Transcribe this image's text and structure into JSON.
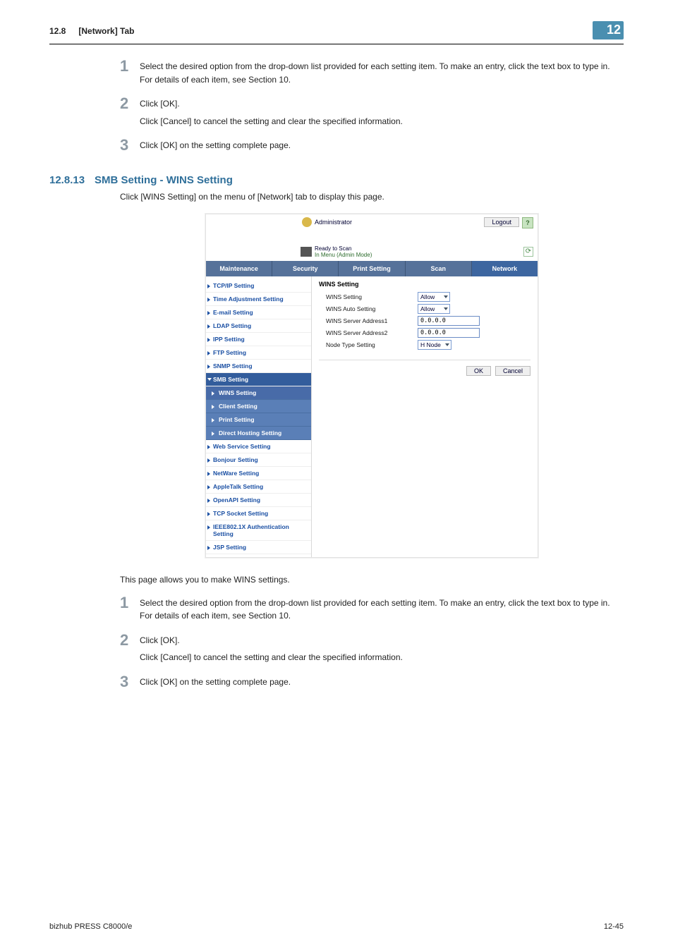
{
  "header": {
    "section": "12.8",
    "title": "[Network] Tab",
    "badge": "12"
  },
  "steps_a": [
    {
      "num": "1",
      "paras": [
        "Select the desired option from the drop-down list provided for each setting item. To make an entry, click the text box to type in. For details of each item, see Section 10."
      ]
    },
    {
      "num": "2",
      "paras": [
        "Click [OK].",
        "Click [Cancel] to cancel the setting and clear the specified information."
      ]
    },
    {
      "num": "3",
      "paras": [
        "Click [OK] on the setting complete page."
      ]
    }
  ],
  "subsection": {
    "num": "12.8.13",
    "title": "SMB Setting - WINS Setting",
    "intro": "Click [WINS Setting] on the menu of [Network] tab to display this page."
  },
  "scr": {
    "admin_label": "Administrator",
    "logout": "Logout",
    "help": "?",
    "ready": "Ready to Scan",
    "menu_link": "In Menu (Admin Mode)",
    "refresh": "⟳",
    "tabs": [
      "Maintenance",
      "Security",
      "Print Setting",
      "Scan",
      "Network"
    ],
    "tab_selected": 4,
    "nav": [
      {
        "label": "TCP/IP Setting"
      },
      {
        "label": "Time Adjustment Setting"
      },
      {
        "label": "E-mail Setting"
      },
      {
        "label": "LDAP Setting"
      },
      {
        "label": "IPP Setting"
      },
      {
        "label": "FTP Setting"
      },
      {
        "label": "SNMP Setting"
      }
    ],
    "nav_expanded_label": "SMB Setting",
    "nav_sub": [
      {
        "label": "WINS Setting",
        "selected": true
      },
      {
        "label": "Client Setting"
      },
      {
        "label": "Print Setting"
      },
      {
        "label": "Direct Hosting Setting"
      }
    ],
    "nav_after": [
      {
        "label": "Web Service Setting"
      },
      {
        "label": "Bonjour Setting"
      },
      {
        "label": "NetWare Setting"
      },
      {
        "label": "AppleTalk Setting"
      },
      {
        "label": "OpenAPI Setting"
      },
      {
        "label": "TCP Socket Setting"
      },
      {
        "label": "IEEE802.1X Authentication Setting"
      },
      {
        "label": "JSP Setting"
      }
    ],
    "main": {
      "heading": "WINS Setting",
      "rows": [
        {
          "label": "WINS Setting",
          "type": "select",
          "value": "Allow"
        },
        {
          "label": "WINS Auto Setting",
          "type": "select",
          "value": "Allow"
        },
        {
          "label": "WINS Server Address1",
          "type": "text",
          "value": "0.0.0.0"
        },
        {
          "label": "WINS Server Address2",
          "type": "text",
          "value": "0.0.0.0"
        },
        {
          "label": "Node Type Setting",
          "type": "select",
          "value": "H Node"
        }
      ],
      "ok": "OK",
      "cancel": "Cancel"
    }
  },
  "para_after_scr": "This page allows you to make WINS settings.",
  "steps_b": [
    {
      "num": "1",
      "paras": [
        "Select the desired option from the drop-down list provided for each setting item. To make an entry, click the text box to type in. For details of each item, see Section 10."
      ]
    },
    {
      "num": "2",
      "paras": [
        "Click [OK].",
        "Click [Cancel] to cancel the setting and clear the specified information."
      ]
    },
    {
      "num": "3",
      "paras": [
        "Click [OK] on the setting complete page."
      ]
    }
  ],
  "footer": {
    "left": "bizhub PRESS C8000/e",
    "right": "12-45"
  }
}
